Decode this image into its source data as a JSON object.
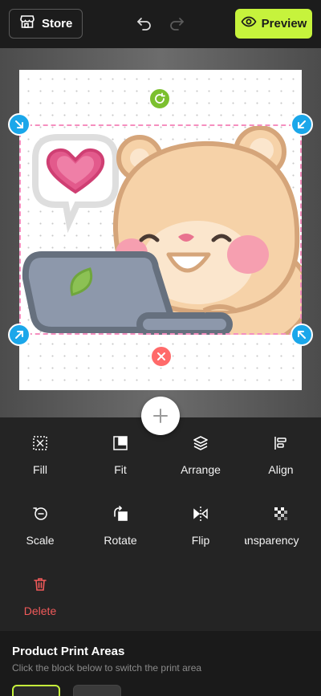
{
  "header": {
    "store_label": "Store",
    "preview_label": "Preview",
    "accent": "#c6f33c"
  },
  "canvas": {
    "selection_color": "#f58fbf",
    "handle_color": "#1ba7ea",
    "rotate_color": "#7cc02f",
    "delete_color": "#ff6a6a",
    "image_description_icons": [
      "heart-speech-bubble-icon",
      "bear-with-laptop-illustration"
    ]
  },
  "tools": [
    {
      "label": "Fill",
      "icon": "fill-icon"
    },
    {
      "label": "Fit",
      "icon": "fit-icon"
    },
    {
      "label": "Arrange",
      "icon": "layers-icon"
    },
    {
      "label": "Align",
      "icon": "align-left-icon"
    },
    {
      "label": "Scale",
      "icon": "scale-icon"
    },
    {
      "label": "Rotate",
      "icon": "rotate-icon"
    },
    {
      "label": "Flip",
      "icon": "flip-icon"
    },
    {
      "label": "Transparency",
      "icon": "transparency-icon"
    },
    {
      "label": "Delete",
      "icon": "trash-icon"
    }
  ],
  "print_areas": {
    "title": "Product Print Areas",
    "subtitle": "Click the block below to switch the print area"
  }
}
